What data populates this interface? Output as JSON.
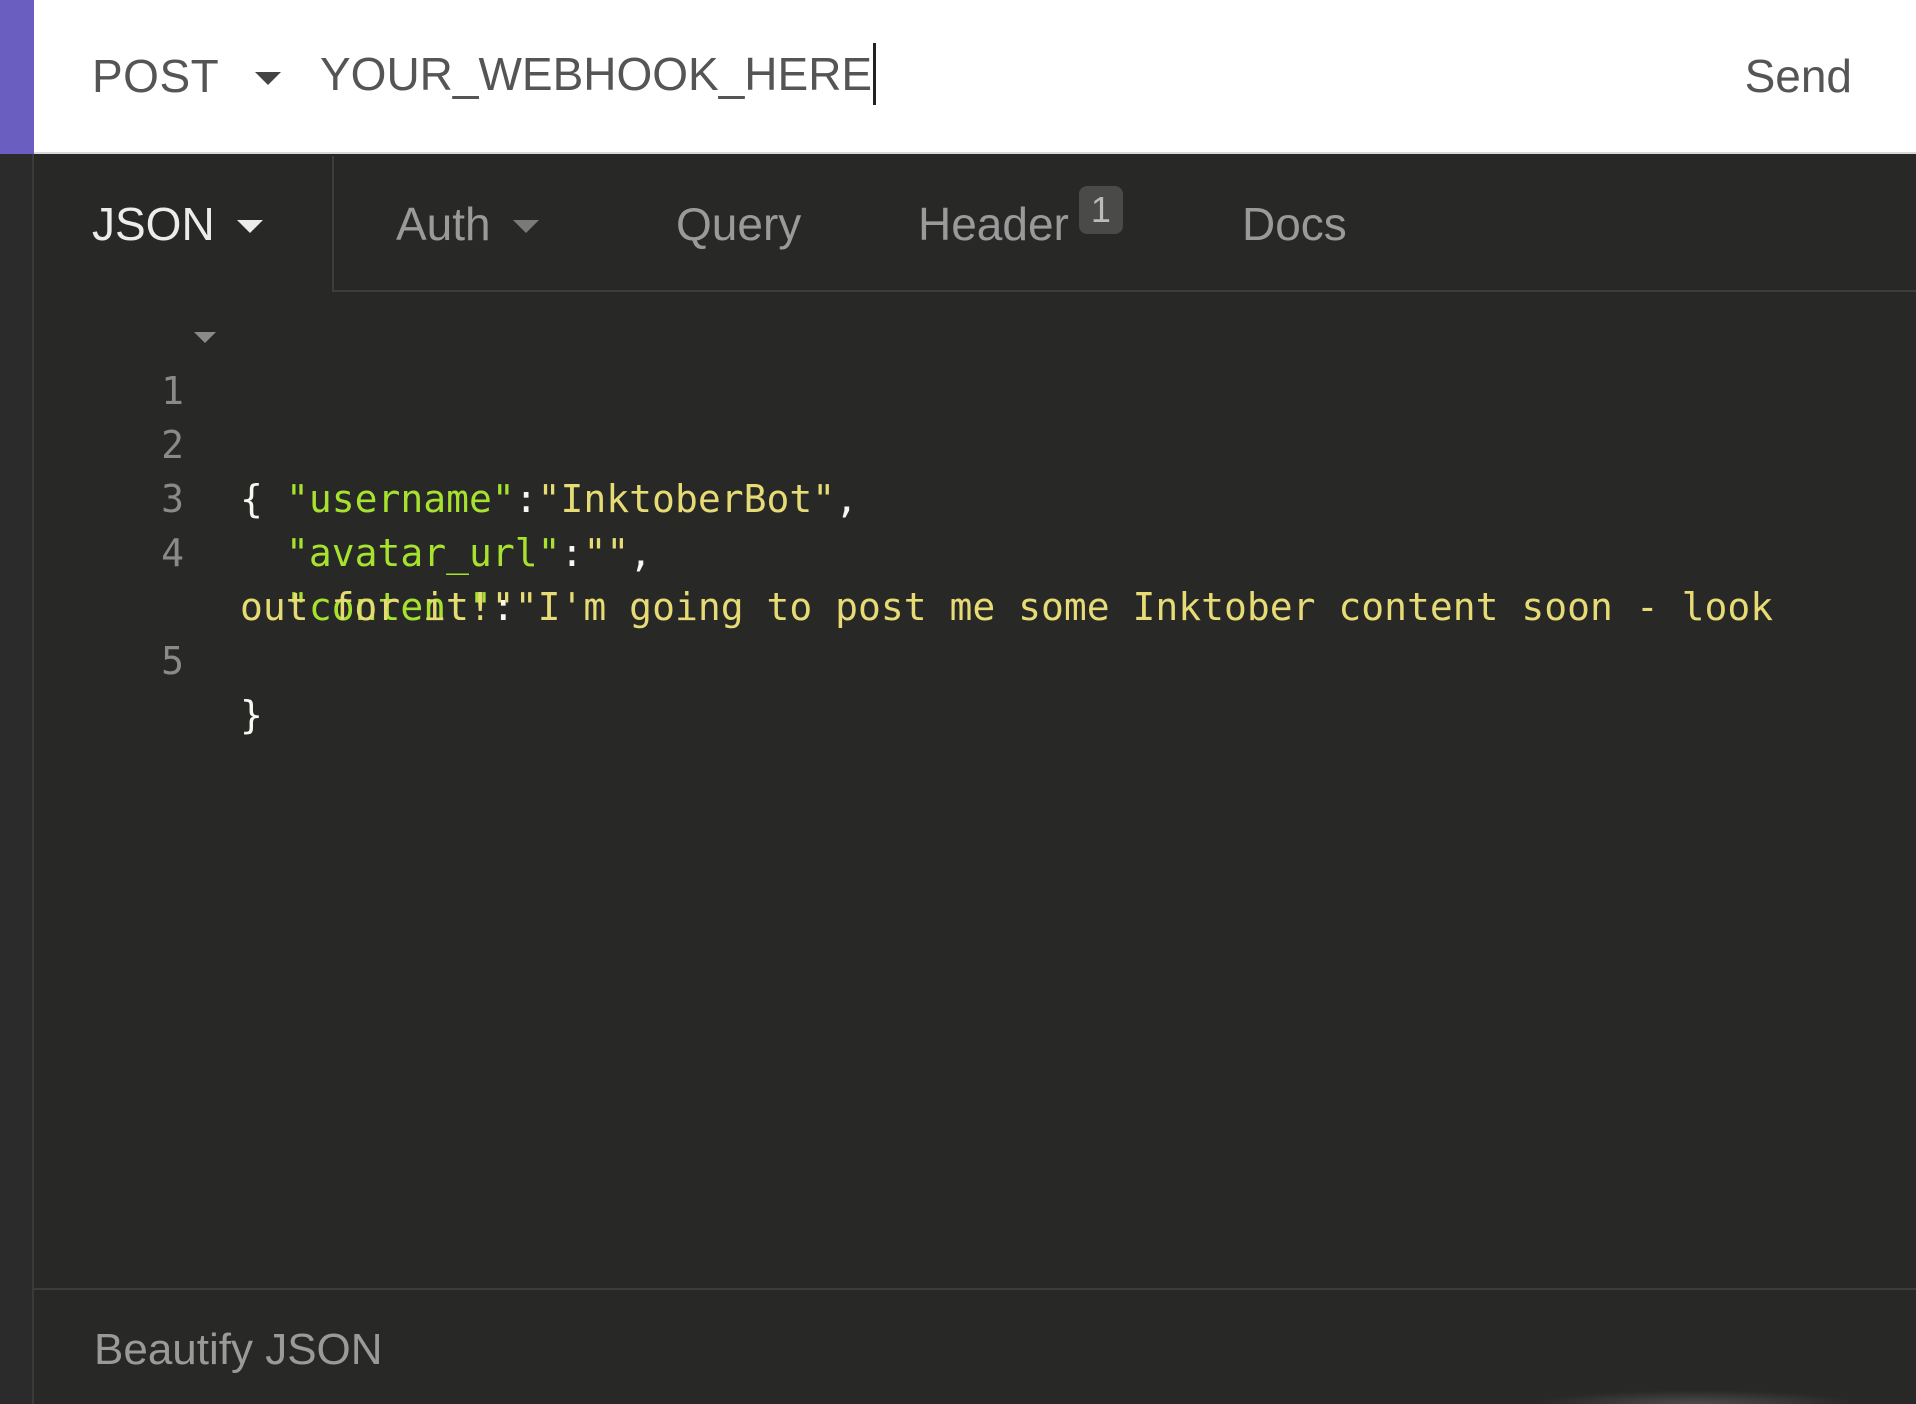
{
  "request": {
    "method": "POST",
    "url": "YOUR_WEBHOOK_HERE",
    "send_label": "Send"
  },
  "tabs": [
    {
      "label": "JSON",
      "active": true,
      "has_dropdown": true
    },
    {
      "label": "Auth",
      "active": false,
      "has_dropdown": true
    },
    {
      "label": "Query",
      "active": false
    },
    {
      "label": "Header",
      "active": false,
      "badge": "1"
    },
    {
      "label": "Docs",
      "active": false
    }
  ],
  "editor": {
    "lines": [
      {
        "num": "1",
        "open_brace": "{"
      },
      {
        "num": "2",
        "key": "\"username\"",
        "sep": ":",
        "value": "\"InktoberBot\"",
        "trail": ","
      },
      {
        "num": "3",
        "key": "\"avatar_url\"",
        "sep": ":",
        "value": "\"\"",
        "trail": ","
      },
      {
        "num": "4",
        "key": "\"content\"",
        "sep": ":",
        "value": "\"I'm going to post me some Inktober content soon - look",
        "value_cont": "out for it!\""
      },
      {
        "num": "5",
        "close_brace": "}"
      }
    ]
  },
  "footer": {
    "beautify_label": "Beautify JSON"
  },
  "colors": {
    "accent": "#6a5fc1",
    "editor_bg": "#282927",
    "json_key": "#a6e22e",
    "json_string": "#e6db74"
  }
}
